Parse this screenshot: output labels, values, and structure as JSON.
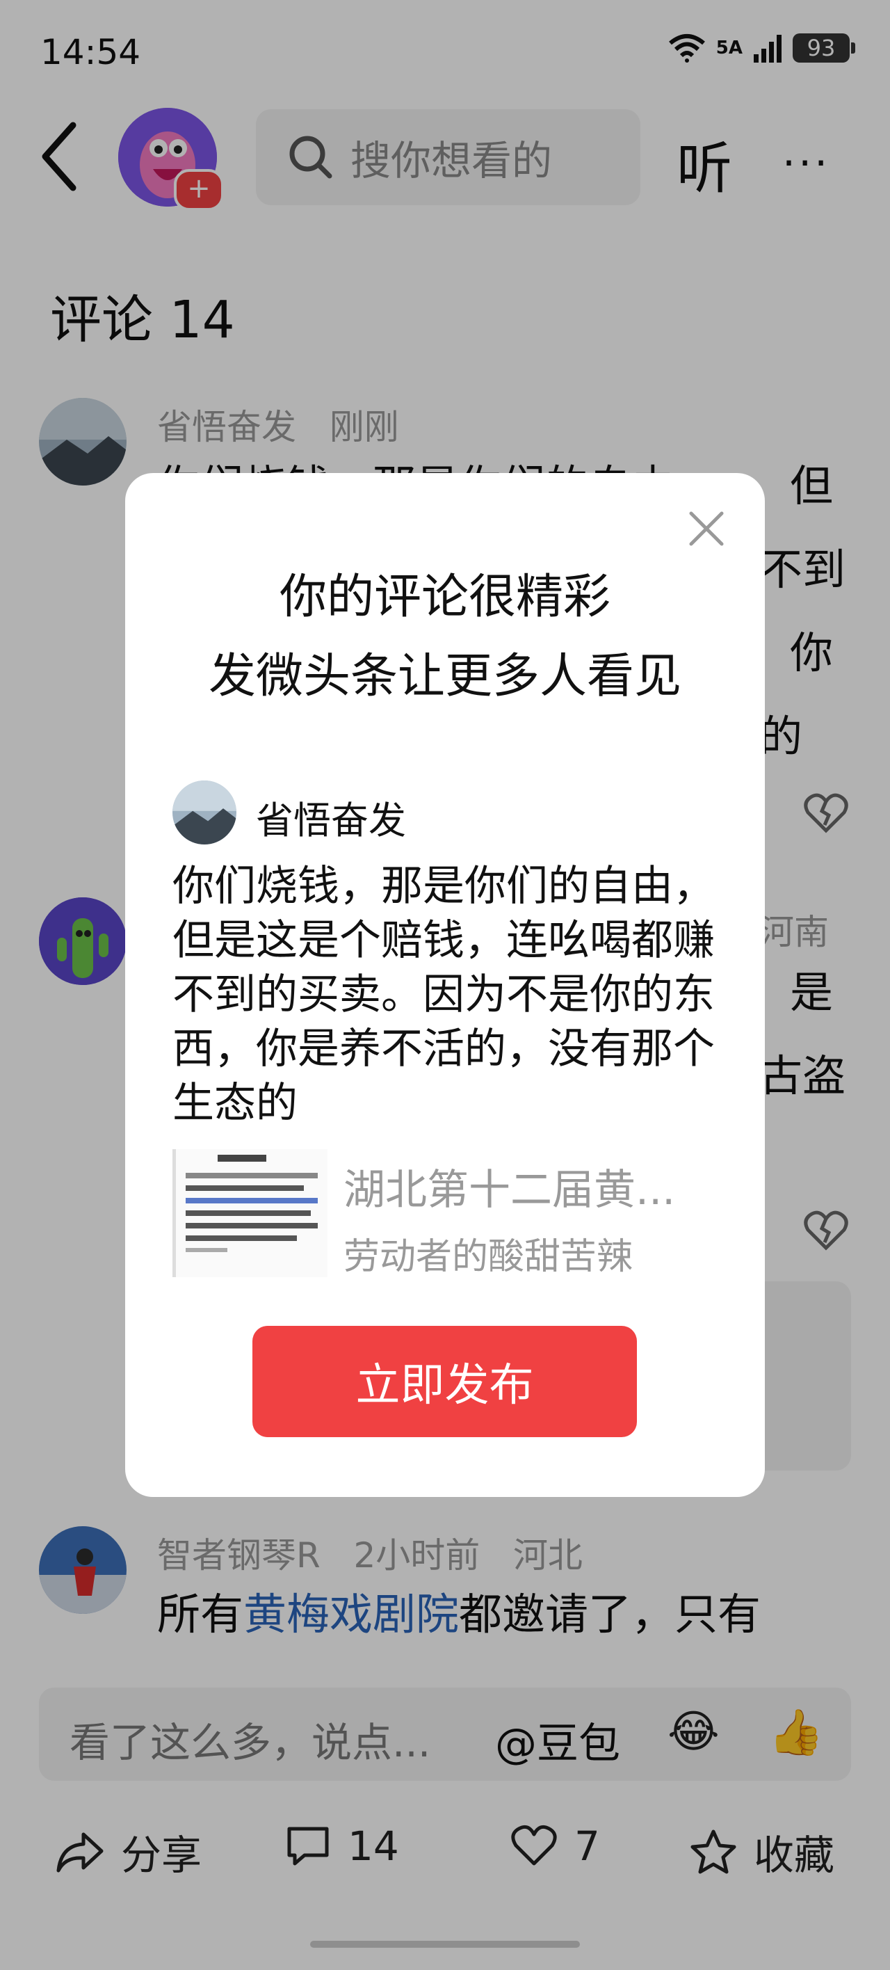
{
  "status_bar": {
    "time": "14:54",
    "network": "5A",
    "battery": "93"
  },
  "nav": {
    "search_placeholder": "搜你想看的",
    "listen_label": "听",
    "more_label": "···"
  },
  "comments_title": "评论 14",
  "comments": [
    {
      "user": "省悟奋发",
      "time": "刚刚",
      "location": "",
      "line1_left": "你们烧钱，那是你们的自由，",
      "line1_right": "但",
      "frag2": "不到",
      "frag3": "你",
      "frag4": "的"
    },
    {
      "user": "",
      "time": "",
      "location": "河南",
      "frag1": "是",
      "frag2": "古盗"
    },
    {
      "user": "智者钢琴R",
      "time": "2小时前",
      "location": "河北",
      "text_before": "所有",
      "text_link": "黄梅戏剧院",
      "text_after": "都邀请了，只有"
    }
  ],
  "input": {
    "placeholder": "看了这么多，说点...",
    "doubao": "@豆包"
  },
  "bottom_bar": {
    "share": "分享",
    "comment_count": "14",
    "like_count": "7",
    "favorite": "收藏"
  },
  "modal": {
    "title_line1": "你的评论很精彩",
    "title_line2": "发微头条让更多人看见",
    "username": "省悟奋发",
    "comment_text": "你们烧钱，那是你们的自由，但是这是个赔钱，连吆喝都赚不到的买卖。因为不是你的东西，你是养不活的，没有那个生态的",
    "card_title": "湖北第十二届黄...",
    "card_source": "劳动者的酸甜苦辣",
    "publish_button": "立即发布"
  }
}
